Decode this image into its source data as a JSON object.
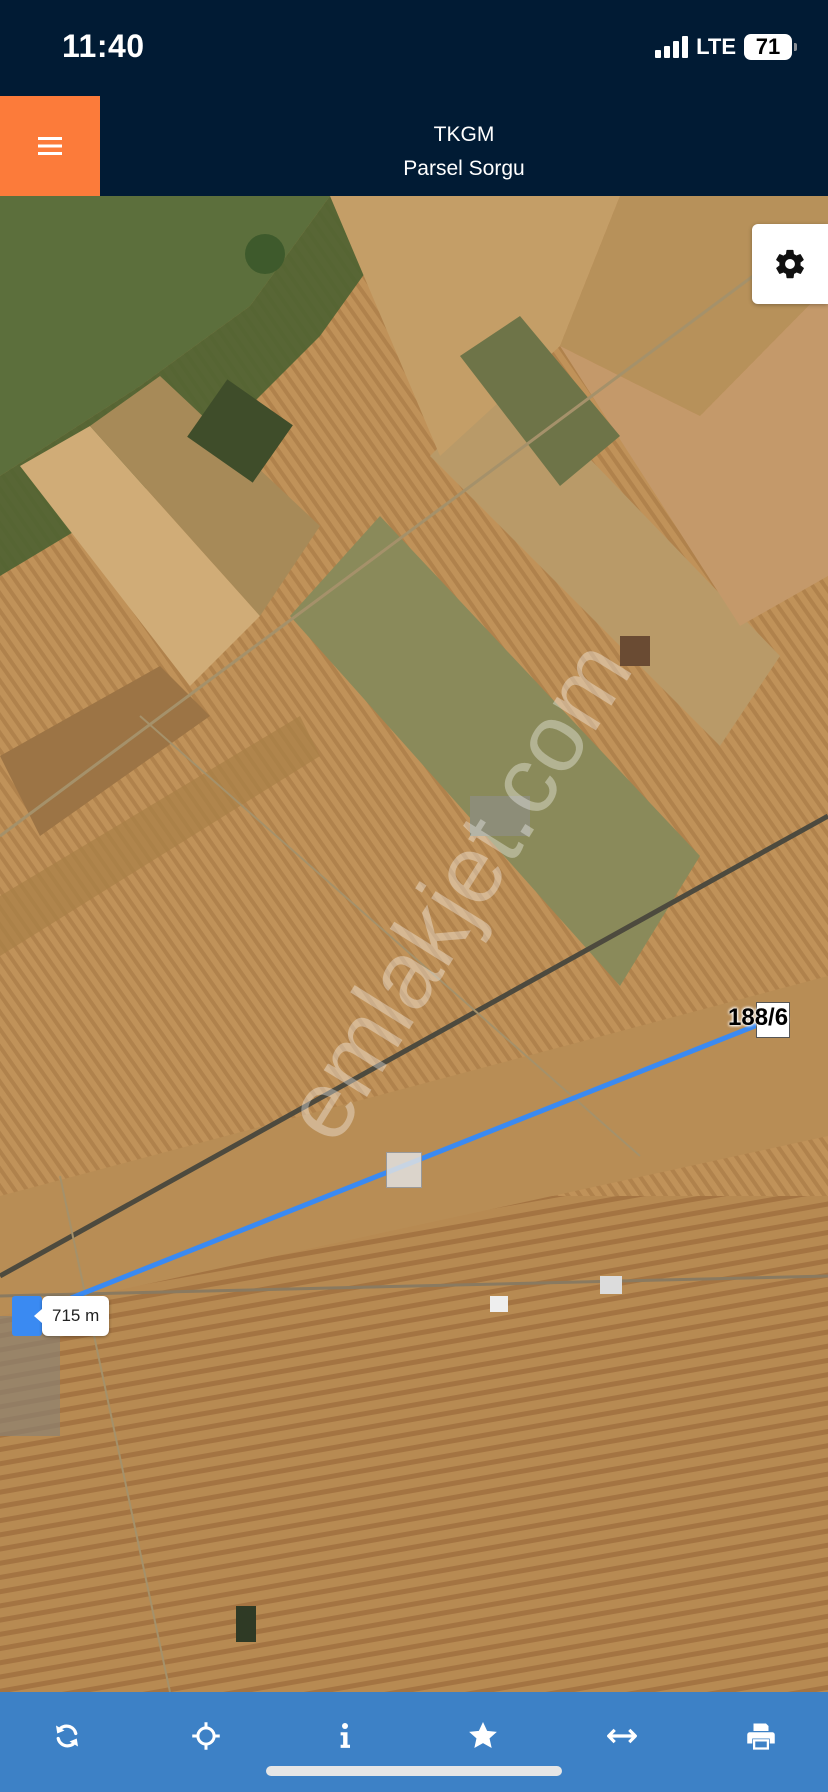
{
  "status": {
    "time": "11:40",
    "network": "LTE",
    "battery": "71"
  },
  "header": {
    "title": "TKGM",
    "subtitle": "Parsel Sorgu",
    "menu_icon": "hamburger-menu-icon",
    "accent_color": "#fc7b3a",
    "background_color": "#011b34"
  },
  "map": {
    "parcel_label": "188/6",
    "distance_label": "715 m",
    "watermark": "emlakjet.com",
    "line_color": "#3a8af2",
    "settings_icon": "gear-icon"
  },
  "toolbar": {
    "background_color": "#3d81c6",
    "buttons": [
      {
        "icon": "refresh-icon"
      },
      {
        "icon": "crosshair-icon"
      },
      {
        "icon": "info-icon"
      },
      {
        "icon": "star-icon"
      },
      {
        "icon": "measure-icon"
      },
      {
        "icon": "print-icon"
      }
    ]
  }
}
